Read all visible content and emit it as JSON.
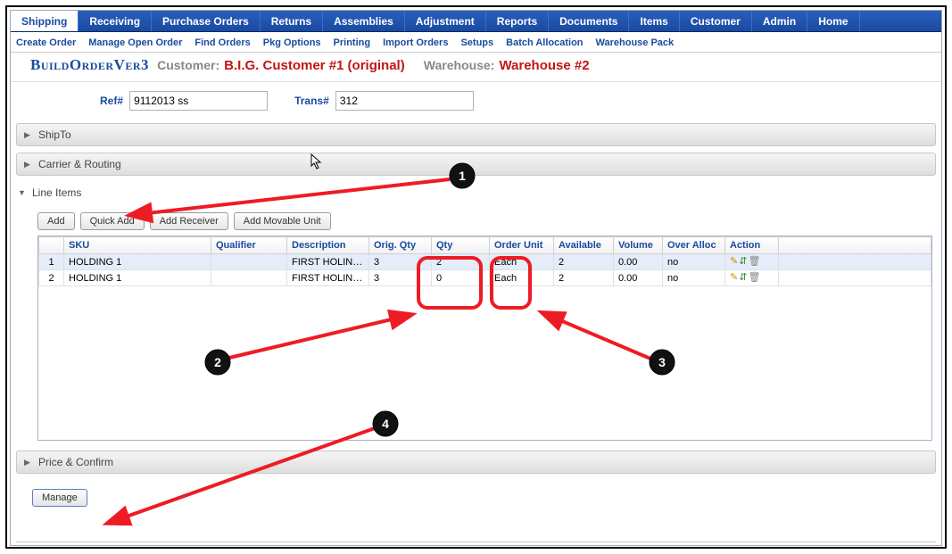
{
  "nav": {
    "main": [
      "Shipping",
      "Receiving",
      "Purchase Orders",
      "Returns",
      "Assemblies",
      "Adjustment",
      "Reports",
      "Documents",
      "Items",
      "Customer",
      "Admin",
      "Home"
    ],
    "main_active_index": 0,
    "sub": [
      "Create Order",
      "Manage Open Order",
      "Find Orders",
      "Pkg Options",
      "Printing",
      "Import Orders",
      "Setups",
      "Batch Allocation",
      "Warehouse Pack"
    ]
  },
  "title": {
    "page": "BuildOrderVer3",
    "customer_label": "Customer:",
    "customer_value": "B.I.G. Customer #1 (original)",
    "warehouse_label": "Warehouse:",
    "warehouse_value": "Warehouse #2"
  },
  "fields": {
    "ref_label": "Ref#",
    "ref_value": "9112013 ss",
    "trans_label": "Trans#",
    "trans_value": "312"
  },
  "sections": {
    "shipto": "ShipTo",
    "carrier": "Carrier & Routing",
    "lineitems": "Line Items",
    "price": "Price & Confirm"
  },
  "buttons": {
    "add": "Add",
    "quick_add": "Quick Add",
    "add_receiver": "Add Receiver",
    "add_movable": "Add Movable Unit",
    "manage": "Manage"
  },
  "grid": {
    "headers": {
      "row": "",
      "sku": "SKU",
      "qualifier": "Qualifier",
      "description": "Description",
      "orig_qty": "Orig. Qty",
      "qty": "Qty",
      "order_unit": "Order Unit",
      "available": "Available",
      "volume": "Volume",
      "over_alloc": "Over Alloc",
      "action": "Action"
    },
    "rows": [
      {
        "n": "1",
        "sku": "HOLDING 1",
        "qualifier": "",
        "description": "FIRST HOLING…",
        "orig_qty": "3",
        "qty": "2",
        "order_unit": "Each",
        "available": "2",
        "volume": "0.00",
        "over_alloc": "no"
      },
      {
        "n": "2",
        "sku": "HOLDING 1",
        "qualifier": "",
        "description": "FIRST HOLING…",
        "orig_qty": "3",
        "qty": "0",
        "order_unit": "Each",
        "available": "2",
        "volume": "0.00",
        "over_alloc": "no"
      }
    ]
  },
  "callouts": {
    "b1": "1",
    "b2": "2",
    "b3": "3",
    "b4": "4"
  }
}
